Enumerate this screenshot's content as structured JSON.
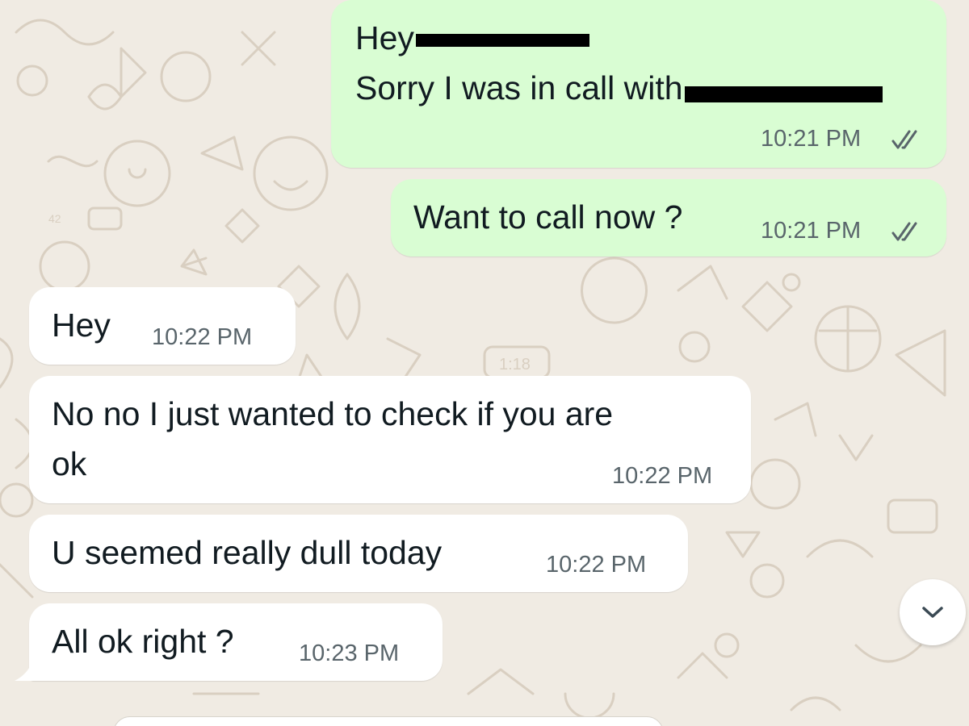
{
  "wallpaper": {
    "background_color": "#f0ebe3",
    "doodle_color": "#d9cfc1",
    "doodle_labels": [
      "42",
      "1:18"
    ]
  },
  "colors": {
    "outgoing_bubble": "#d9fdd3",
    "incoming_bubble": "#ffffff",
    "text": "#111b21",
    "timestamp": "#59656b",
    "read_ticks": "#59656b"
  },
  "messages": [
    {
      "direction": "outgoing",
      "lines": [
        "Hey",
        "Sorry I was in call with"
      ],
      "redacted_after_line": [
        true,
        true
      ],
      "time": "10:21 PM",
      "status": "read",
      "status_icon": "double-check-icon"
    },
    {
      "direction": "outgoing",
      "lines": [
        "Want to call now ?"
      ],
      "time": "10:21 PM",
      "status": "read",
      "status_icon": "double-check-icon"
    },
    {
      "direction": "incoming",
      "lines": [
        "Hey"
      ],
      "time": "10:22 PM"
    },
    {
      "direction": "incoming",
      "lines": [
        "No no I just wanted to check if you are",
        "ok"
      ],
      "time": "10:22 PM"
    },
    {
      "direction": "incoming",
      "lines": [
        "U seemed really dull today"
      ],
      "time": "10:22 PM"
    },
    {
      "direction": "incoming",
      "lines": [
        "All ok right ?"
      ],
      "time": "10:23 PM"
    }
  ],
  "scroll_to_bottom": {
    "icon": "chevron-down-icon"
  },
  "composer": {
    "placeholder": ""
  }
}
